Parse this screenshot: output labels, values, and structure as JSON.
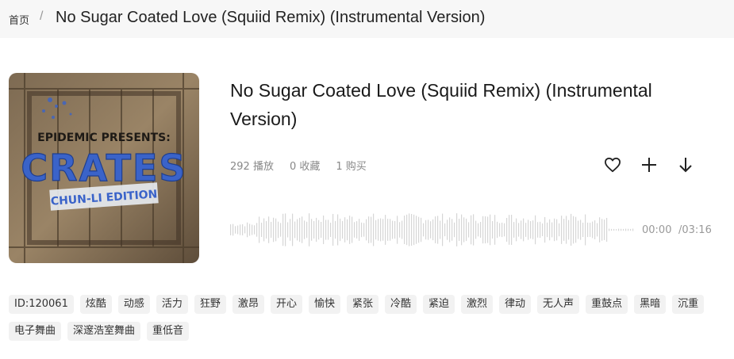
{
  "breadcrumb": {
    "home": "首页",
    "separator": "/",
    "current": "No Sugar Coated Love (Squiid Remix) (Instrumental Version)"
  },
  "cover": {
    "line1": "EPIDEMIC PRESENTS:",
    "line2": "CRATES",
    "line3": "CHUN-LI EDITION"
  },
  "track": {
    "title": "No Sugar Coated Love (Squiid Remix) (Instrumental Version)",
    "plays": "292 播放",
    "favorites": "0 收藏",
    "purchases": "1 购买"
  },
  "actions": {
    "like_icon": "heart-icon",
    "add_icon": "plus-icon",
    "download_icon": "download-arrow-icon"
  },
  "player": {
    "current_time": "00:00",
    "duration": "/03:16"
  },
  "tags": [
    "ID:120061",
    "炫酷",
    "动感",
    "活力",
    "狂野",
    "激昂",
    "开心",
    "愉快",
    "紧张",
    "冷酷",
    "紧迫",
    "激烈",
    "律动",
    "无人声",
    "重鼓点",
    "黑暗",
    "沉重",
    "电子舞曲",
    "深邃浩室舞曲",
    "重低音"
  ],
  "colors": {
    "topbar_bg": "#f7f7f7",
    "tag_bg": "#f2f2f2",
    "waveform": "#d6d6d6",
    "crates_blue": "#3a63c9"
  }
}
